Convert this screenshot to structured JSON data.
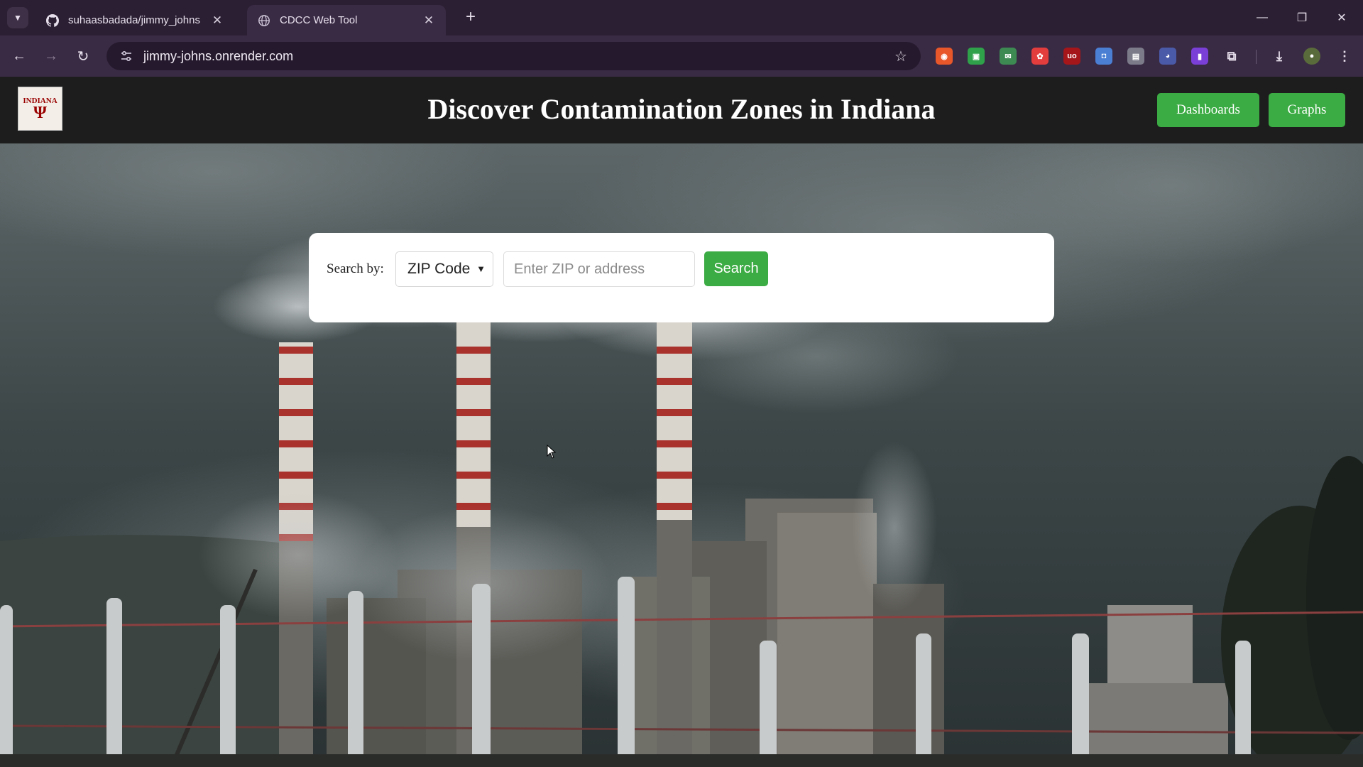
{
  "browser": {
    "tabs": [
      {
        "title": "suhaasbadada/jimmy_johns",
        "icon": "github-icon",
        "active": false
      },
      {
        "title": "CDCC Web Tool",
        "icon": "globe-icon",
        "active": true
      }
    ],
    "url": "jimmy-johns.onrender.com"
  },
  "header": {
    "logo_word": "INDIANA",
    "logo_mark": "Ψ",
    "title": "Discover Contamination Zones in Indiana",
    "buttons": {
      "dashboards": "Dashboards",
      "graphs": "Graphs"
    }
  },
  "search": {
    "label": "Search by:",
    "select_value": "ZIP Code",
    "input_placeholder": "Enter ZIP or address",
    "button": "Search"
  },
  "colors": {
    "accent_green": "#3bab43",
    "header_bg": "#1d1d1d",
    "chrome_bg": "#2b1f33"
  }
}
